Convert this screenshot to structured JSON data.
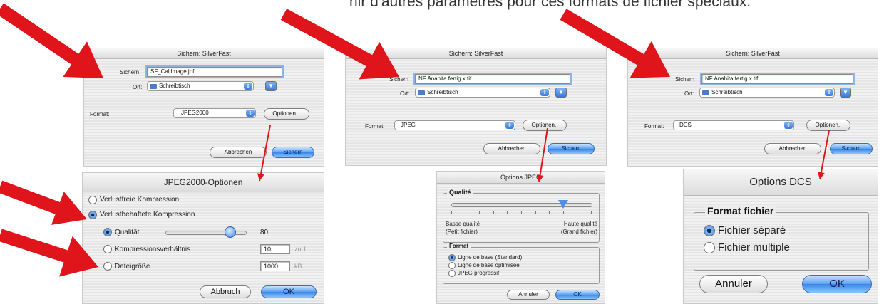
{
  "page": {
    "heading": "nir d'autres paramètres pour ces formats de fichier spéciaux."
  },
  "save_dialog_1": {
    "title": "Sichern: SilverFast",
    "save_label": "Sichern",
    "filename": "SF_CallImage.jpf",
    "location_label": "Ort:",
    "location_value": "Schreibtisch",
    "format_label": "Format:",
    "format_value": "JPEG2000",
    "options_button": "Optionen...",
    "cancel_button": "Abbrechen",
    "save_button": "Sichern"
  },
  "save_dialog_2": {
    "title": "Sichern: SilverFast",
    "save_label": "Sichern",
    "filename": "NF Anahita fertig x.tif",
    "location_label": "Ort:",
    "location_value": "Schreibtisch",
    "format_label": "Format:",
    "format_value": "JPEG",
    "options_button": "Optionen..",
    "cancel_button": "Abbrechen",
    "save_button": "Sichern"
  },
  "save_dialog_3": {
    "title": "Sichern: SilverFast",
    "save_label": "Sichern",
    "filename": "NF Anahita fertig x.tif",
    "location_label": "Ort:",
    "location_value": "Schreibtisch",
    "format_label": "Format:",
    "format_value": "DCS",
    "options_button": "Optionen..",
    "cancel_button": "Abbrechen",
    "save_button": "Sichern"
  },
  "jpeg2000_options": {
    "title": "JPEG2000-Optionen",
    "lossless_label": "Verlustfreie Kompression",
    "lossy_label": "Verlustbehaftete Kompression",
    "quality_label": "Qualität",
    "quality_value": "80",
    "quality_level": 0.8,
    "ratio_label": "Kompressionsverhältnis",
    "ratio_value": "10",
    "ratio_unit": "zu 1",
    "filesize_label": "Dateigröße",
    "filesize_value": "1000",
    "filesize_unit": "kB",
    "cancel_button": "Abbruch",
    "ok_button": "OK"
  },
  "jpeg_options": {
    "title": "Options JPEG",
    "quality_group": "Qualité",
    "low_quality": "Basse qualité",
    "low_quality_sub": "(Petit fichier)",
    "high_quality": "Haute qualité",
    "high_quality_sub": "(Grand fichier)",
    "quality_level": 0.8,
    "format_group": "Format",
    "format_options": [
      "Ligne de base (Standard)",
      "Ligne de base optimisée",
      "JPEG progressif"
    ],
    "cancel_button": "Annuler",
    "ok_button": "OK"
  },
  "dcs_options": {
    "title": "Options DCS",
    "format_group": "Format fichier",
    "separate_file": "Fichier séparé",
    "multiple_file": "Fichier multiple",
    "cancel_button": "Annuler",
    "ok_button": "OK"
  },
  "colors": {
    "arrow_red": "#e0141b",
    "aqua_blue": "#3a85e6"
  }
}
